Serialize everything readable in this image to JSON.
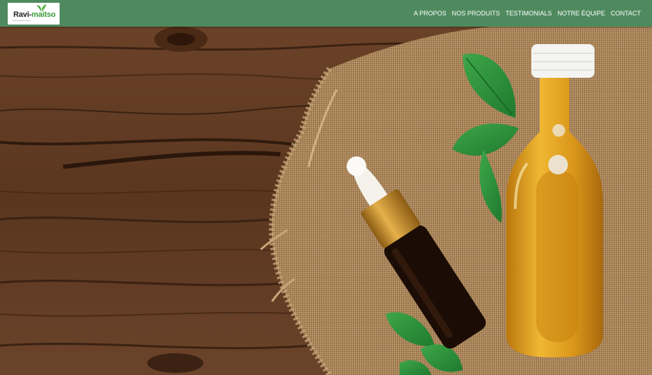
{
  "brand": {
    "name_part1": "Ravi-",
    "name_part2": "maitso",
    "tagline": "Huiles Essentielles Premium",
    "accent_color": "#3d9a3c"
  },
  "nav": {
    "background_color": "#4f8a5e",
    "links": [
      {
        "label": "A PROPOS"
      },
      {
        "label": "NOS PRODUITS"
      },
      {
        "label": "TESTIMONIALS"
      },
      {
        "label": "NOTRE ÉQUIPE"
      },
      {
        "label": "CONTACT"
      }
    ]
  },
  "hero": {
    "image_description_icons": [
      "wood-table",
      "burlap-cloth",
      "dropper-bottle-icon",
      "oil-bottle-icon",
      "mint-leaf-icon"
    ]
  }
}
